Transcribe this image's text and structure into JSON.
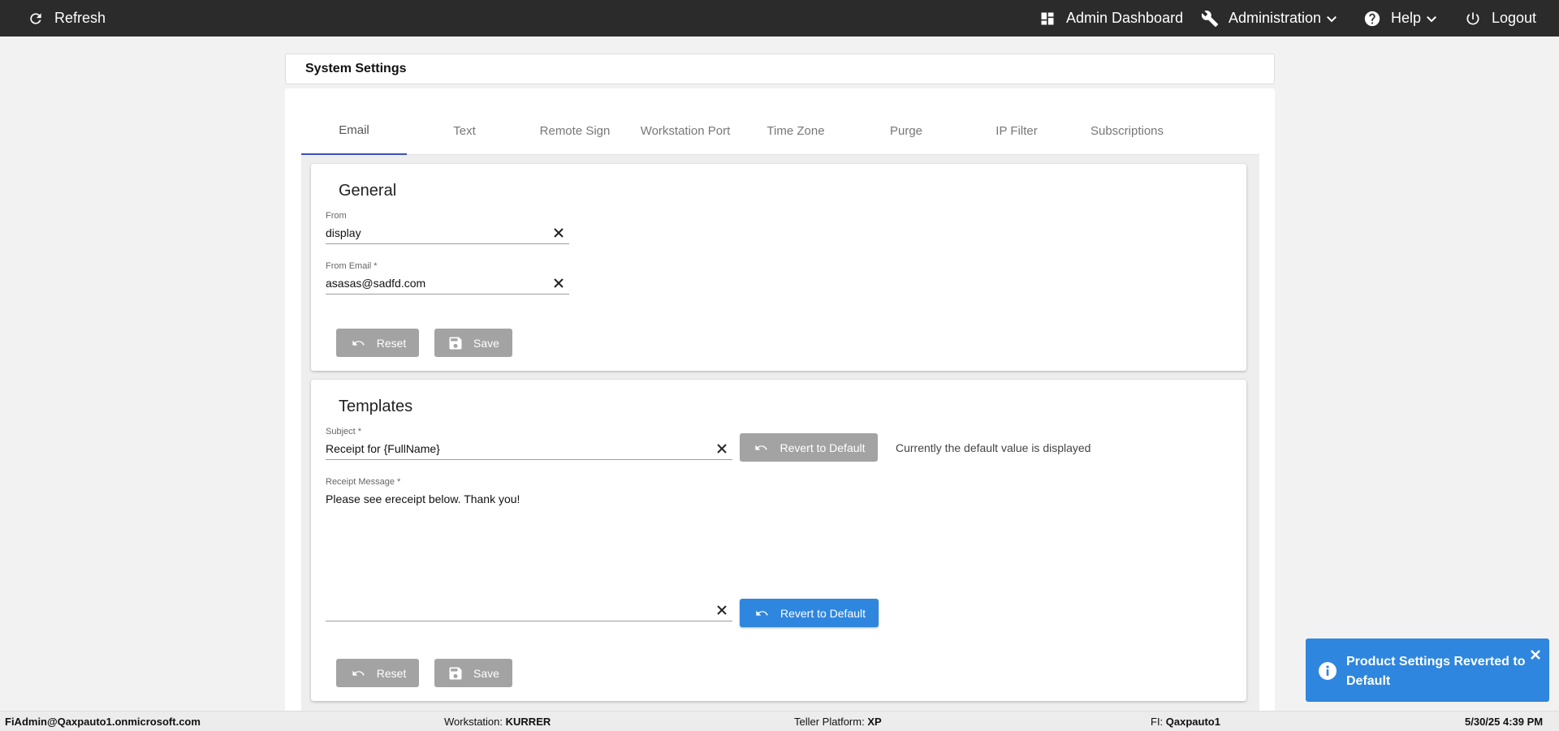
{
  "topbar": {
    "refresh_label": "Refresh",
    "dashboard_label": "Admin Dashboard",
    "administration_label": "Administration",
    "help_label": "Help",
    "logout_label": "Logout"
  },
  "page": {
    "title": "System Settings"
  },
  "tabs": [
    {
      "label": "Email",
      "active": true
    },
    {
      "label": "Text"
    },
    {
      "label": "Remote Sign"
    },
    {
      "label": "Workstation Port"
    },
    {
      "label": "Time Zone"
    },
    {
      "label": "Purge"
    },
    {
      "label": "IP Filter"
    },
    {
      "label": "Subscriptions"
    }
  ],
  "general": {
    "heading": "General",
    "from": {
      "label": "From",
      "value": "display"
    },
    "from_email": {
      "label": "From Email *",
      "value": "asasas@sadfd.com"
    },
    "reset_label": "Reset",
    "save_label": "Save"
  },
  "templates": {
    "heading": "Templates",
    "subject": {
      "label": "Subject *",
      "value": "Receipt for {FullName}"
    },
    "revert_label": "Revert to Default",
    "default_note": "Currently the default value is displayed",
    "receipt": {
      "label": "Receipt Message *",
      "value": "Please see ereceipt below. Thank you!"
    },
    "revert2_label": "Revert to Default",
    "reset_label": "Reset",
    "save_label": "Save"
  },
  "toast": {
    "message": "Product Settings Reverted to Default"
  },
  "statusbar": {
    "user": "FiAdmin@Qaxpauto1.onmicrosoft.com",
    "workstation_label": "Workstation:",
    "workstation_value": "KURRER",
    "teller_label": "Teller Platform:",
    "teller_value": "XP",
    "fi_label": "FI:",
    "fi_value": "Qaxpauto1",
    "datetime": "5/30/25 4:39 PM"
  },
  "colors": {
    "topbar": "#2b2b2b",
    "accent_tab": "#3f51b5",
    "primary_button": "#2e86de",
    "disabled_button": "#a3a3a3",
    "toast": "#2e86de"
  },
  "icons": {
    "refresh": "refresh-icon",
    "dashboard": "dashboard-icon",
    "administration": "wrench-icon",
    "help": "help-icon",
    "logout": "power-icon",
    "clear": "close-icon",
    "reset": "undo-icon",
    "save": "floppy-icon",
    "toast": "info-icon"
  }
}
